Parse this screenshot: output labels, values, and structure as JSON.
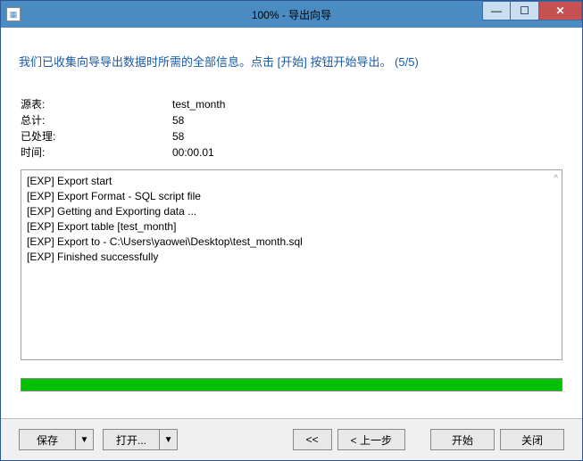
{
  "titlebar": {
    "title": "100% - 导出向导"
  },
  "instruction": "我们已收集向导导出数据时所需的全部信息。点击 [开始] 按钮开始导出。 (5/5)",
  "details": {
    "source_label": "源表:",
    "source_value": "test_month",
    "total_label": "总计:",
    "total_value": "58",
    "processed_label": "已处理:",
    "processed_value": "58",
    "time_label": "时间:",
    "time_value": "00:00.01"
  },
  "log": [
    "[EXP] Export start",
    "[EXP] Export Format - SQL script file",
    "[EXP] Getting and Exporting data ...",
    "[EXP] Export table [test_month]",
    "[EXP] Export to - C:\\Users\\yaowei\\Desktop\\test_month.sql",
    "[EXP] Finished successfully"
  ],
  "progress": {
    "percent": 100,
    "color": "#00c000"
  },
  "footer": {
    "save": "保存",
    "open": "打开...",
    "first": "<<",
    "prev": "< 上一步",
    "start": "开始",
    "close": "关闭",
    "dropdown_glyph": "▼"
  }
}
